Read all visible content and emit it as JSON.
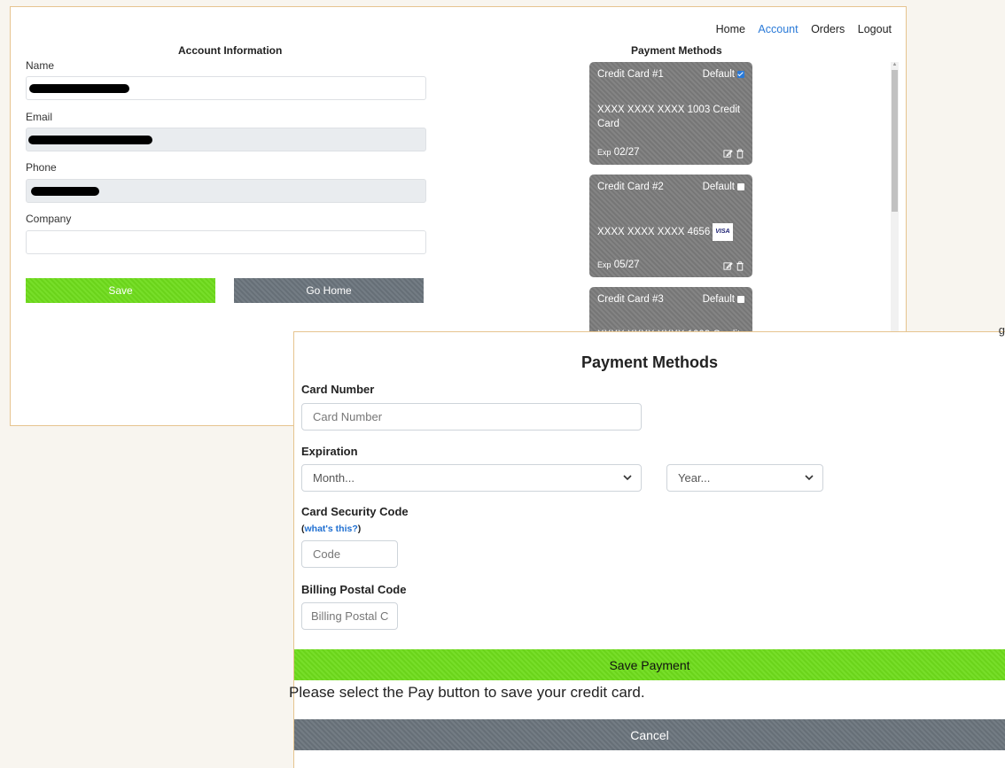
{
  "nav": {
    "items": [
      {
        "label": "Home",
        "active": false
      },
      {
        "label": "Account",
        "active": true
      },
      {
        "label": "Orders",
        "active": false
      },
      {
        "label": "Logout",
        "active": false
      }
    ]
  },
  "account": {
    "title": "Account Information",
    "name_label": "Name",
    "email_label": "Email",
    "phone_label": "Phone",
    "company_label": "Company",
    "save_label": "Save",
    "home_label": "Go Home"
  },
  "payment_list": {
    "title": "Payment Methods",
    "cards": [
      {
        "name": "Credit Card #1",
        "default_label": "Default",
        "is_default": true,
        "number": "XXXX XXXX XXXX 1003 Credit Card",
        "exp_prefix": "Exp",
        "exp": "02/27"
      },
      {
        "name": "Credit Card #2",
        "default_label": "Default",
        "is_default": false,
        "number": "XXXX XXXX XXXX 4656",
        "brand": "VISA",
        "exp_prefix": "Exp",
        "exp": "05/27"
      },
      {
        "name": "Credit Card #3",
        "default_label": "Default",
        "is_default": false,
        "number": "XXXX XXXX XXXX 1003 Credit",
        "exp_prefix": "",
        "exp": ""
      }
    ]
  },
  "modal": {
    "title": "Payment Methods",
    "card_number_label": "Card Number",
    "card_number_placeholder": "Card Number",
    "expiration_label": "Expiration",
    "month_value": "Month...",
    "year_value": "Year...",
    "csc_label": "Card Security Code",
    "whats_this_open": "(",
    "whats_this": "what's this?",
    "whats_this_close": ")",
    "code_placeholder": "Code",
    "postal_label": "Billing Postal Code",
    "postal_placeholder": "Billing Postal C",
    "save_payment_label": "Save Payment",
    "message": "Please select the Pay button to save your credit card.",
    "cancel_label": "Cancel",
    "right_fragment": "g"
  },
  "colors": {
    "accent_green": "#6fdc1c",
    "gray_button": "#6c757d",
    "link_blue": "#2a7ad8",
    "frame": "#e6c48f"
  }
}
